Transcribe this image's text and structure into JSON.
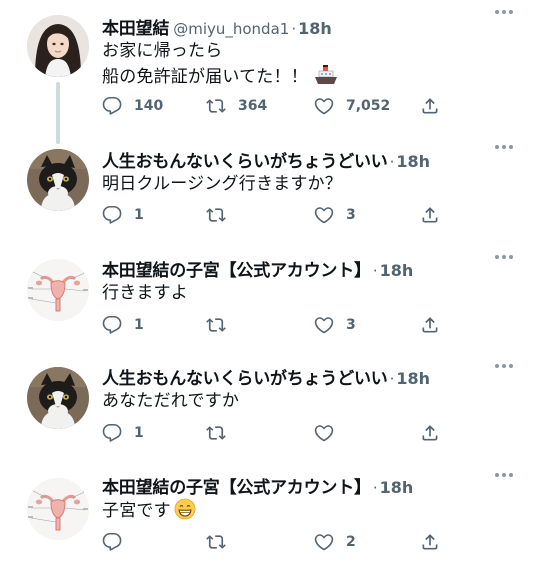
{
  "colors": {
    "text": "#0f1419",
    "muted": "#536471",
    "thread_line": "#cfd9de",
    "icon": "#536471"
  },
  "tweets": [
    {
      "avatar": "woman-avatar",
      "name": "本田望結",
      "handle": "@miyu_honda1",
      "separator": "·",
      "time": "18h",
      "lines": [
        "お家に帰ったら",
        "船の免許証が届いてた！！"
      ],
      "trailing_emoji": "ship-emoji",
      "reply_count": "140",
      "retweet_count": "364",
      "like_count": "7,052"
    },
    {
      "avatar": "cat-avatar",
      "name": "人生おもんないくらいがちょうどいい",
      "handle": "",
      "separator": "·",
      "time": "18h",
      "lines": [
        "明日クルージング行きますか？"
      ],
      "reply_count": "1",
      "retweet_count": "",
      "like_count": "3"
    },
    {
      "avatar": "uterus-diagram-avatar",
      "name": "本田望結の子宮【公式アカウント】",
      "handle": "",
      "separator": "·",
      "time": "18h",
      "lines": [
        "行きますよ"
      ],
      "reply_count": "1",
      "retweet_count": "",
      "like_count": "3"
    },
    {
      "avatar": "cat-avatar",
      "name": "人生おもんないくらいがちょうどいい",
      "handle": "",
      "separator": "·",
      "time": "18h",
      "lines": [
        "あなただれですか"
      ],
      "reply_count": "1",
      "retweet_count": "",
      "like_count": ""
    },
    {
      "avatar": "uterus-diagram-avatar",
      "name": "本田望結の子宮【公式アカウント】",
      "handle": "",
      "separator": "·",
      "time": "18h",
      "lines": [
        "子宮です"
      ],
      "trailing_emoji": "grinning-emoji",
      "reply_count": "",
      "retweet_count": "",
      "like_count": "2"
    }
  ]
}
